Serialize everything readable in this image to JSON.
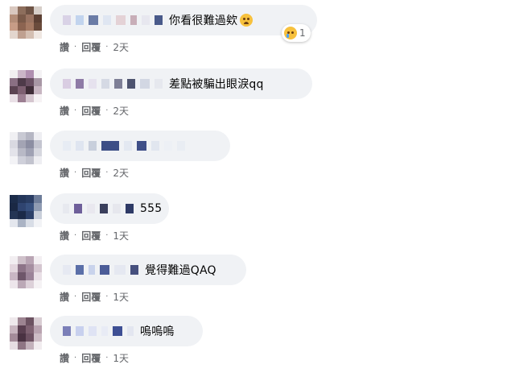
{
  "comments": [
    {
      "text": "你看很難過欸",
      "emoji": "crying-face-icon",
      "reaction_count": "1",
      "like": "讚",
      "reply": "回覆",
      "sep": "·",
      "time": "2天"
    },
    {
      "text": "差點被騙出眼淚qq",
      "like": "讚",
      "reply": "回覆",
      "sep": "·",
      "time": "2天"
    },
    {
      "text": "",
      "like": "讚",
      "reply": "回覆",
      "sep": "·",
      "time": "2天"
    },
    {
      "text": "555",
      "like": "讚",
      "reply": "回覆",
      "sep": "·",
      "time": "1天"
    },
    {
      "text": "覺得難過QAQ",
      "like": "讚",
      "reply": "回覆",
      "sep": "·",
      "time": "1天"
    },
    {
      "text": "嗚嗚嗚",
      "like": "讚",
      "reply": "回覆",
      "sep": "·",
      "time": "1天"
    }
  ],
  "colors": {
    "bubble": "#f0f2f5",
    "meta": "#65676b",
    "text": "#050505"
  }
}
